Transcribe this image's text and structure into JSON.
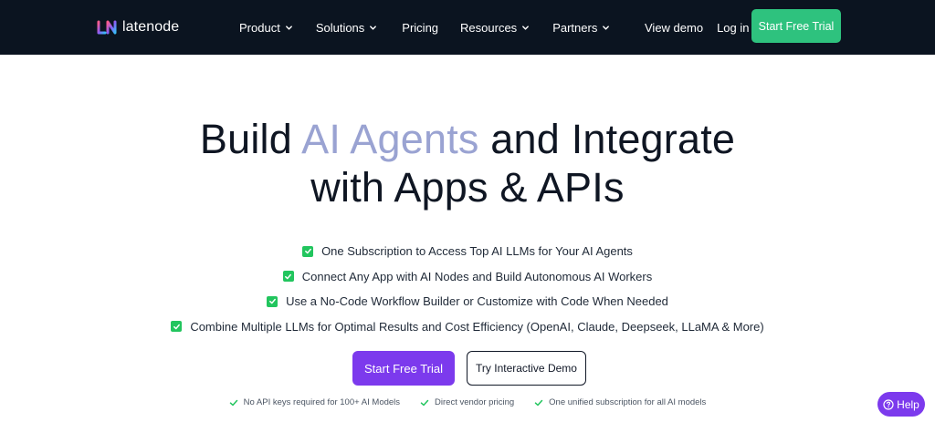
{
  "nav": {
    "brand": "latenode",
    "menu": [
      {
        "label": "Product",
        "has_dropdown": true
      },
      {
        "label": "Solutions",
        "has_dropdown": true
      },
      {
        "label": "Pricing",
        "has_dropdown": false
      },
      {
        "label": "Resources",
        "has_dropdown": true
      },
      {
        "label": "Partners",
        "has_dropdown": true
      }
    ],
    "view_demo": "View demo",
    "login": "Log in",
    "cta": "Start Free Trial"
  },
  "hero": {
    "title_line1_pre": "Build ",
    "title_accent": "AI Agents",
    "title_line1_post": " and Integrate",
    "title_line2": "with Apps & APIs",
    "features": [
      "One Subscription to Access Top AI LLMs for Your AI Agents",
      "Connect Any App with AI Nodes and Build Autonomous AI Workers",
      "Use a No-Code Workflow Builder or Customize with Code When Needed",
      "Combine Multiple LLMs for Optimal Results and Cost Efficiency (OpenAI, Claude, Deepseek, LLaMA & More)"
    ],
    "primary_cta": "Start Free Trial",
    "secondary_cta": "Try Interactive Demo",
    "notes": [
      "No API keys required for 100+ AI Models",
      "Direct vendor pricing",
      "One unified subscription for all AI models"
    ]
  },
  "help": {
    "label": "Help"
  },
  "colors": {
    "nav_bg": "#0b1420",
    "nav_cta": "#2ec27e",
    "accent_text": "#9aa3d2",
    "primary": "#7c3aed",
    "check": "#22c55e"
  },
  "icons": {
    "logo": "latenode-logo-icon",
    "dropdown": "chevron-down-icon",
    "feature": "checkbox-checked-icon",
    "note": "check-icon",
    "help": "question-circle-icon"
  }
}
